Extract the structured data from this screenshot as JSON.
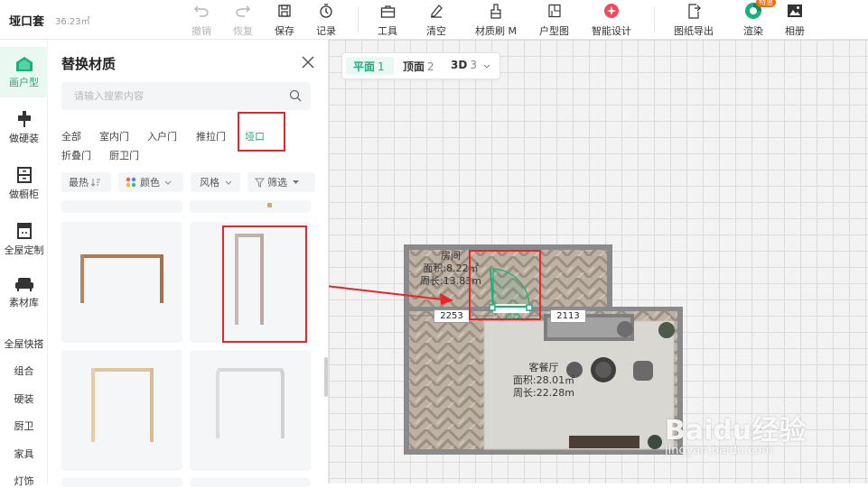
{
  "app": {
    "title": "垭口套",
    "area": "36.23㎡"
  },
  "toolbar": [
    {
      "label": "撤销",
      "icon": "undo-icon",
      "disabled": true
    },
    {
      "label": "恢复",
      "icon": "redo-icon",
      "disabled": true
    },
    {
      "label": "保存",
      "icon": "save-icon",
      "disabled": false
    },
    {
      "label": "记录",
      "icon": "history-icon",
      "disabled": false
    },
    {
      "label": "工具",
      "icon": "toolbox-icon",
      "disabled": false
    },
    {
      "label": "清空",
      "icon": "eraser-icon",
      "disabled": false
    },
    {
      "label": "材质刷 M",
      "icon": "brush-icon",
      "disabled": false
    },
    {
      "label": "户型图",
      "icon": "floorplan-icon",
      "disabled": false
    },
    {
      "label": "智能设计",
      "icon": "ai-design-icon",
      "disabled": false
    },
    {
      "label": "图纸导出",
      "icon": "export-icon",
      "disabled": false
    },
    {
      "label": "渲染",
      "icon": "render-icon",
      "disabled": false,
      "badge": "特惠"
    },
    {
      "label": "相册",
      "icon": "album-icon",
      "disabled": false
    }
  ],
  "leftnav": {
    "items": [
      {
        "label": "画户型",
        "icon": "house-icon",
        "active": true
      },
      {
        "label": "做硬装",
        "icon": "paint-roller-icon",
        "active": false
      },
      {
        "label": "做橱柜",
        "icon": "cabinet-icon",
        "active": false
      },
      {
        "label": "全屋定制",
        "icon": "wardrobe-icon",
        "active": false
      },
      {
        "label": "素材库",
        "icon": "sofa-icon",
        "active": false
      }
    ],
    "sections": [
      "全屋快搭",
      "组合",
      "硬装",
      "厨卫",
      "家具",
      "灯饰"
    ]
  },
  "panel": {
    "title": "替换材质",
    "search_placeholder": "请输入搜索内容",
    "categories": [
      {
        "label": "全部",
        "active": false
      },
      {
        "label": "室内门",
        "active": false
      },
      {
        "label": "入户门",
        "active": false
      },
      {
        "label": "推拉门",
        "active": false
      },
      {
        "label": "垭口",
        "active": true
      },
      {
        "label": "折叠门",
        "active": false
      },
      {
        "label": "厨卫门",
        "active": false
      }
    ],
    "filters": [
      "最热",
      "颜色",
      "风格",
      "筛选"
    ]
  },
  "canvas": {
    "view_tabs": [
      {
        "label": "平面",
        "num": "1",
        "active": true
      },
      {
        "label": "顶面",
        "num": "2",
        "active": false
      },
      {
        "label": "3D",
        "num": "3",
        "active": false
      }
    ],
    "room1": {
      "name": "房间",
      "area": "面积:8.22㎡",
      "perimeter": "周长:13.83m"
    },
    "room2": {
      "name": "客餐厅",
      "area": "面积:28.01㎡",
      "perimeter": "周长:22.28m"
    },
    "dims": {
      "left": "2253",
      "door": "1022",
      "right": "2113"
    }
  },
  "watermark": {
    "brand": "Baidu经验",
    "url": "jingyan.baidu.com"
  },
  "colors": {
    "accent": "#18b07a",
    "annotation": "#e8262a"
  }
}
